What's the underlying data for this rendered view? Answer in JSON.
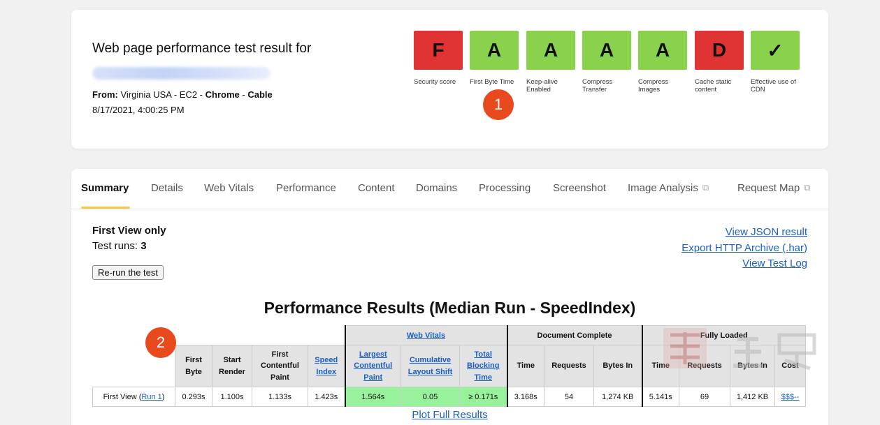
{
  "top": {
    "title": "Web page performance test result for",
    "from_label": "From:",
    "from_location": "Virginia USA - EC2 -",
    "browser": "Chrome",
    "dash": "-",
    "connection": "Cable",
    "date": "8/17/2021, 4:00:25 PM"
  },
  "grades": [
    {
      "letter": "F",
      "label": "Security score",
      "color": "red"
    },
    {
      "letter": "A",
      "label": "First Byte Time",
      "color": "green"
    },
    {
      "letter": "A",
      "label": "Keep-alive Enabled",
      "color": "green"
    },
    {
      "letter": "A",
      "label": "Compress Transfer",
      "color": "green"
    },
    {
      "letter": "A",
      "label": "Compress Images",
      "color": "green"
    },
    {
      "letter": "D",
      "label": "Cache static content",
      "color": "red"
    },
    {
      "letter": "✓",
      "label": "Effective use of CDN",
      "color": "green"
    }
  ],
  "badges": {
    "one": "1",
    "two": "2"
  },
  "tabs": [
    {
      "label": "Summary"
    },
    {
      "label": "Details"
    },
    {
      "label": "Web Vitals"
    },
    {
      "label": "Performance"
    },
    {
      "label": "Content"
    },
    {
      "label": "Domains"
    },
    {
      "label": "Processing"
    },
    {
      "label": "Screenshot"
    },
    {
      "label": "Image Analysis",
      "external": true
    },
    {
      "label": "Request Map",
      "external": true
    }
  ],
  "summary": {
    "first_view_only": "First View only",
    "test_runs_label": "Test runs:",
    "test_runs_value": "3",
    "rerun_button": "Re-run the test",
    "links": [
      "View JSON result",
      "Export HTTP Archive (.har)",
      "View Test Log"
    ],
    "results_title": "Performance Results (Median Run - SpeedIndex)",
    "plot_link": "Plot Full Results"
  },
  "table": {
    "group_headers": {
      "web_vitals": "Web Vitals",
      "document_complete": "Document Complete",
      "fully_loaded": "Fully Loaded"
    },
    "columns": {
      "first_byte": "First Byte",
      "start_render": "Start Render",
      "fcp": "First Contentful Paint",
      "speed_index": "Speed Index",
      "lcp": "Largest Contentful Paint",
      "cls": "Cumulative Layout Shift",
      "tbt": "Total Blocking Time",
      "dc_time": "Time",
      "dc_requests": "Requests",
      "dc_bytes": "Bytes In",
      "fl_time": "Time",
      "fl_requests": "Requests",
      "fl_bytes": "Bytes In",
      "cost": "Cost"
    },
    "row": {
      "label": "First View (",
      "run_link": "Run 1",
      "label_end": ")",
      "first_byte": "0.293s",
      "start_render": "1.100s",
      "fcp": "1.133s",
      "speed_index": "1.423s",
      "lcp": "1.564s",
      "cls": "0.05",
      "tbt": "≥ 0.171s",
      "dc_time": "3.168s",
      "dc_requests": "54",
      "dc_bytes": "1,274 KB",
      "fl_time": "5.141s",
      "fl_requests": "69",
      "fl_bytes": "1,412 KB",
      "cost": "$$$--"
    }
  },
  "colors": {
    "grade_red": "#e03434",
    "grade_green": "#8ad14e",
    "vitals_green": "#98f19b",
    "badge": "#e8491d",
    "link": "#1a5fc8",
    "tab_underline": "#f2c94c"
  }
}
